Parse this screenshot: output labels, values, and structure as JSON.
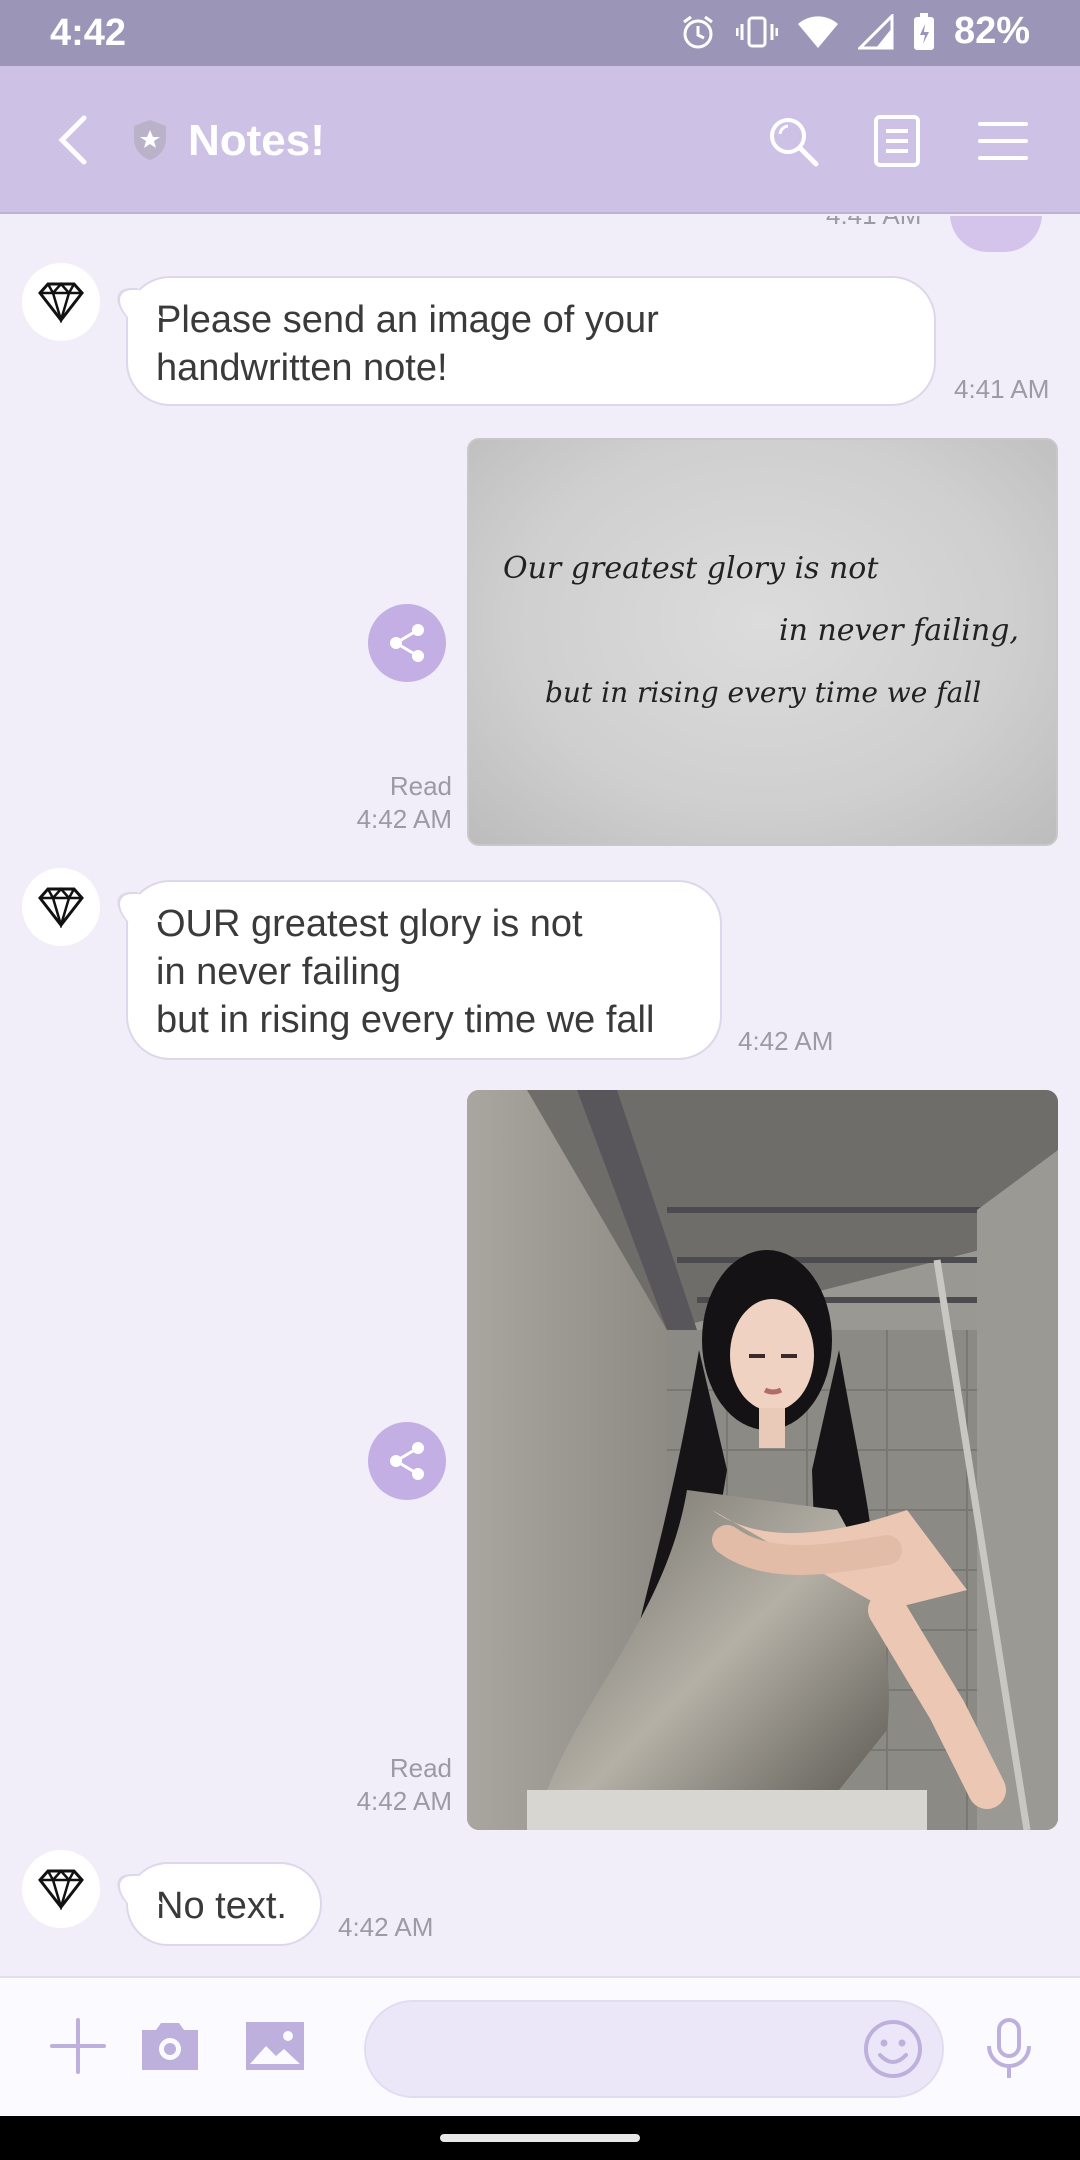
{
  "status_bar": {
    "time": "4:42",
    "battery": "82%"
  },
  "header": {
    "title": "Notes!"
  },
  "messages": [
    {
      "type": "received_text",
      "text": "Please send an image of your\nhandwritten note!",
      "time": "4:41 AM"
    },
    {
      "type": "sent_image",
      "status": "Read",
      "time": "4:42 AM",
      "handwriting": [
        "Our greatest glory is not",
        "in never failing,",
        "but in rising every time we fall"
      ]
    },
    {
      "type": "received_text",
      "text": "OUR greatest glory is not\nin never failing\nbut in rising every time we fall",
      "time": "4:42 AM"
    },
    {
      "type": "sent_image",
      "status": "Read",
      "time": "4:42 AM"
    },
    {
      "type": "received_text",
      "text": "No text.",
      "time": "4:42 AM"
    }
  ],
  "previous_message_time": "4:41 AM",
  "input": {
    "value": ""
  },
  "colors": {
    "status_bar": "#9b95b8",
    "header": "#cdc1e5",
    "chat_background": "#f1eefa",
    "accent": "#c3afe4"
  }
}
